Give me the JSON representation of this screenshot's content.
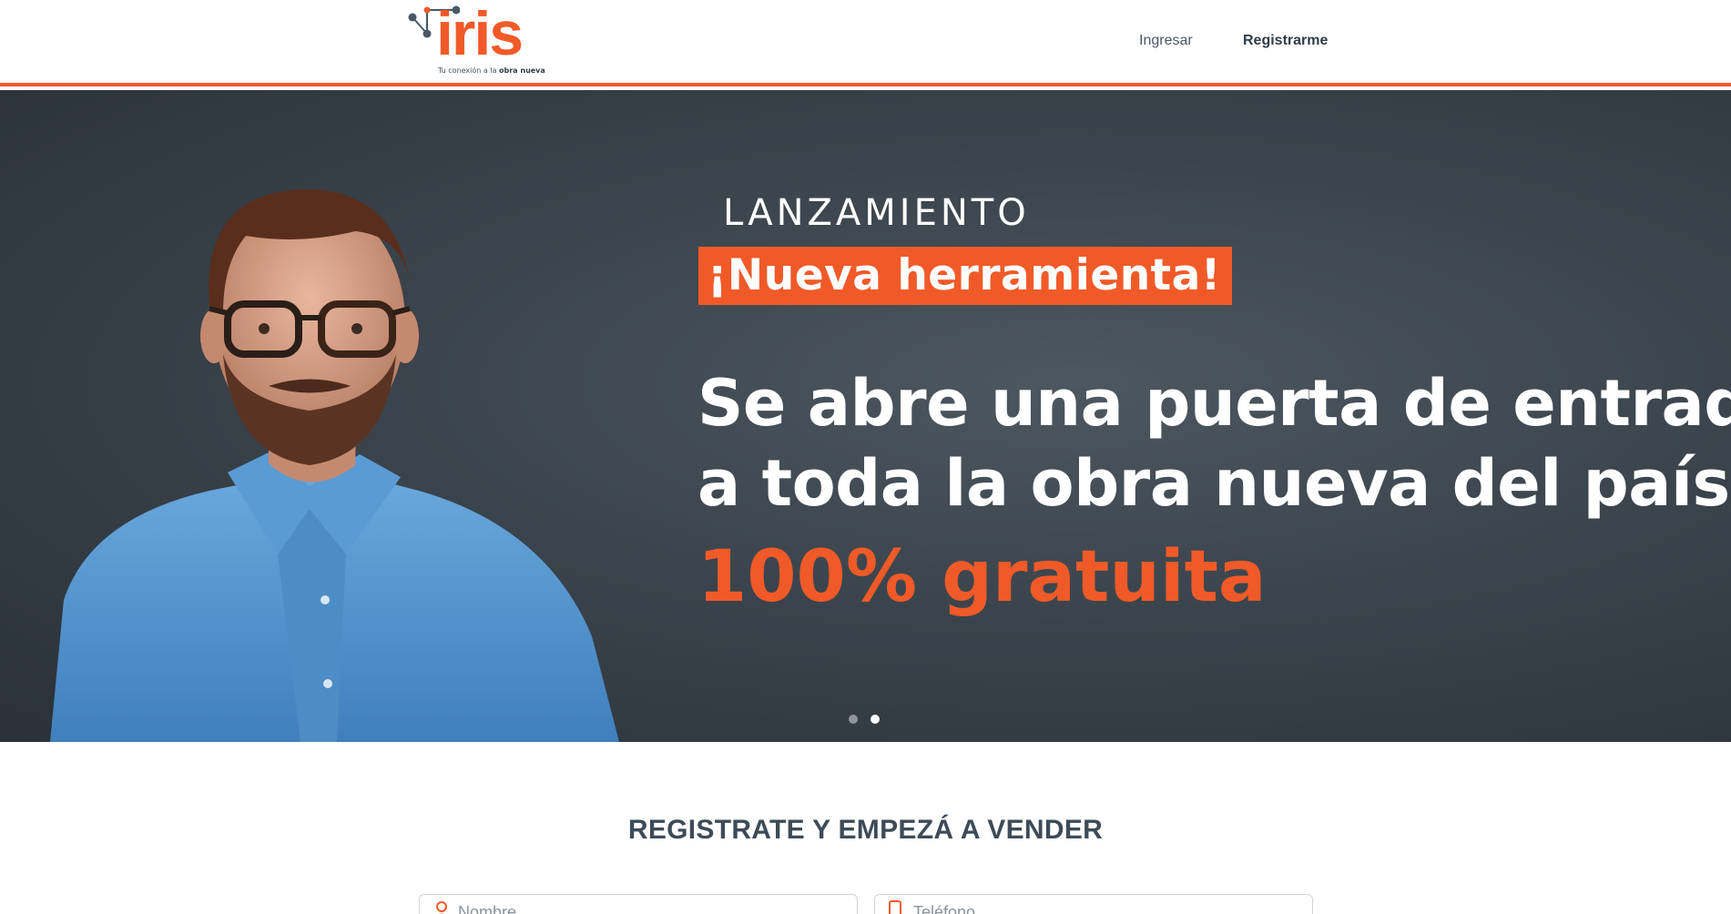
{
  "header": {
    "logo_text": "iris",
    "logo_tagline_prefix": "Tu conexión a la",
    "logo_tagline_bold": "obra nueva",
    "nav": {
      "login_label": "Ingresar",
      "register_label": "Registrarme"
    }
  },
  "hero": {
    "kicker": "LANZAMIENTO",
    "badge": "¡Nueva herramienta!",
    "headline_line1": "Se abre una puerta de entrada",
    "headline_line2": "a toda la obra nueva del país.",
    "highlight": "100% gratuita",
    "slides_total": 2,
    "slide_active": 2
  },
  "register": {
    "title_regular": "REGISTRATE Y",
    "title_bold": "EMPEZÁ A VENDER",
    "name_placeholder": "Nombre",
    "phone_placeholder": "Teléfono"
  },
  "colors": {
    "accent": "#f05a28",
    "hero_bg": "#3b444c",
    "text_dark": "#3d4b58"
  },
  "icons": {
    "name_field": "user-icon",
    "phone_field": "phone-icon"
  }
}
